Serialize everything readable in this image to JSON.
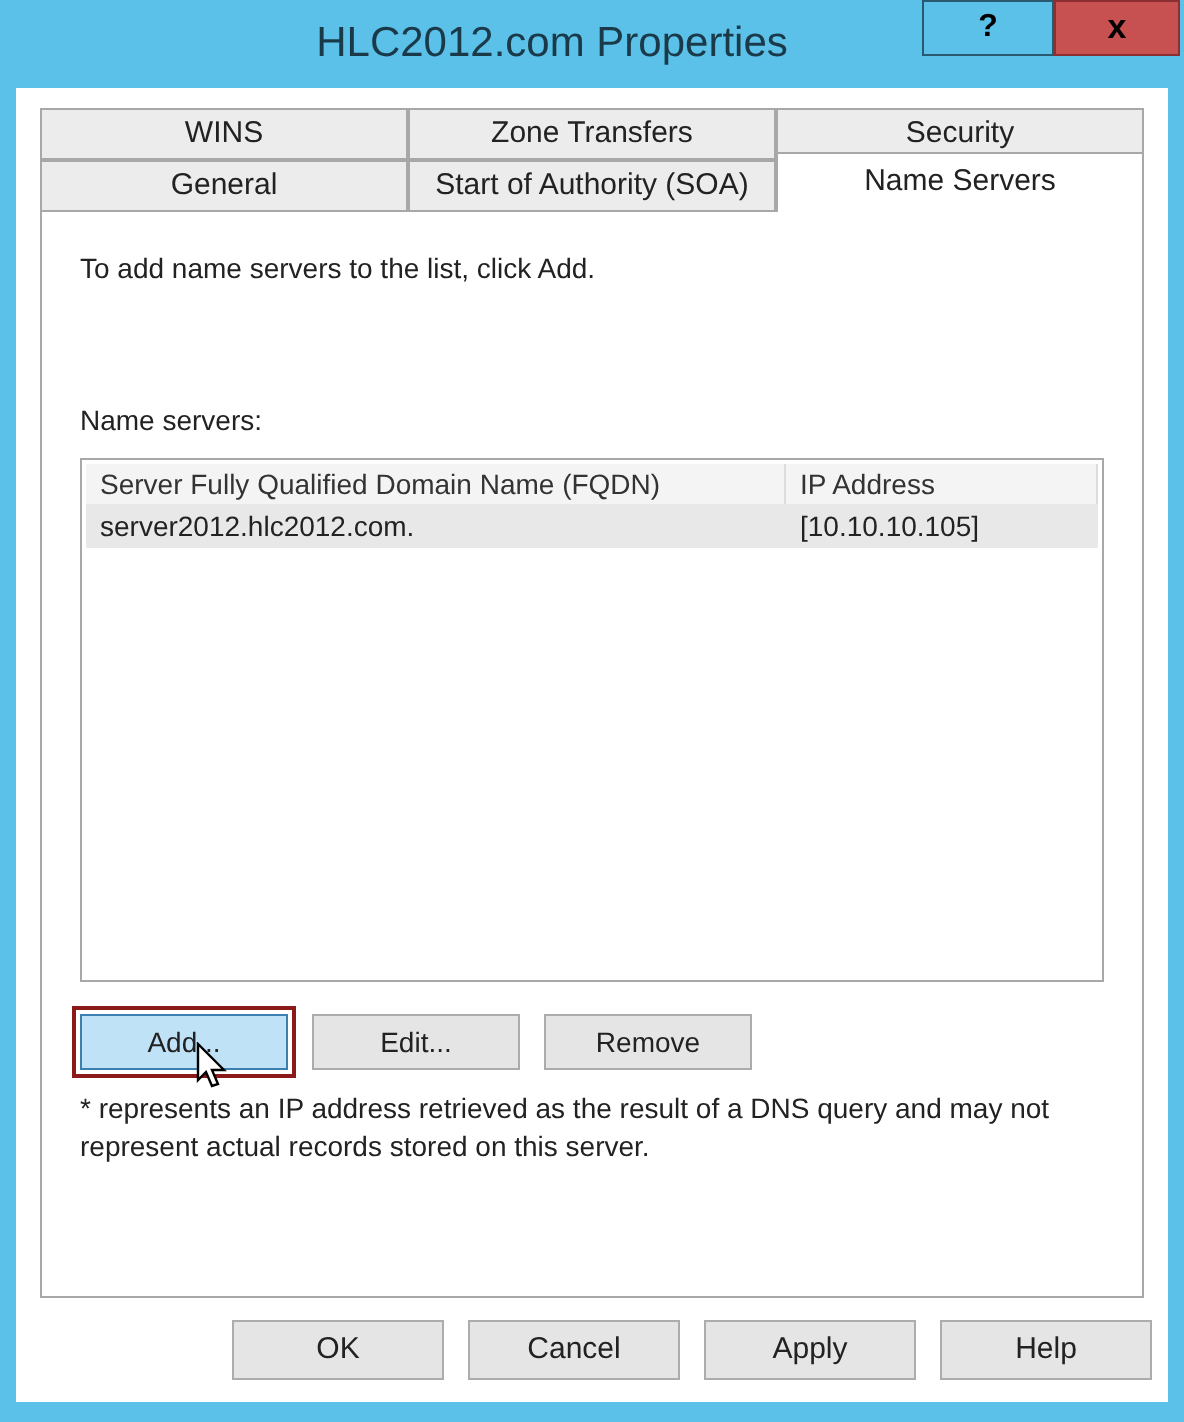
{
  "window": {
    "title": "HLC2012.com Properties",
    "help_button": "?",
    "close_button": "x"
  },
  "tab_rows": [
    [
      {
        "label": "WINS",
        "selected": false
      },
      {
        "label": "Zone Transfers",
        "selected": false
      },
      {
        "label": "Security",
        "selected": false
      }
    ],
    [
      {
        "label": "General",
        "selected": false
      },
      {
        "label": "Start of Authority (SOA)",
        "selected": false
      },
      {
        "label": "Name Servers",
        "selected": true
      }
    ]
  ],
  "instructions": "To add name servers to the list, click Add.",
  "list_label": "Name servers:",
  "table": {
    "columns": [
      "Server Fully Qualified Domain Name (FQDN)",
      "IP Address"
    ],
    "rows": [
      {
        "cells": [
          "server2012.hlc2012.com.",
          "[10.10.10.105]"
        ],
        "selected": true
      }
    ]
  },
  "list_buttons": [
    {
      "label": "Add...",
      "hovered": true
    },
    {
      "label": "Edit...",
      "hovered": false
    },
    {
      "label": "Remove",
      "hovered": false
    }
  ],
  "note": "* represents an IP address retrieved as the result of a DNS query and may not represent actual records stored on this server.",
  "dialog_buttons": [
    "OK",
    "Cancel",
    "Apply",
    "Help"
  ]
}
